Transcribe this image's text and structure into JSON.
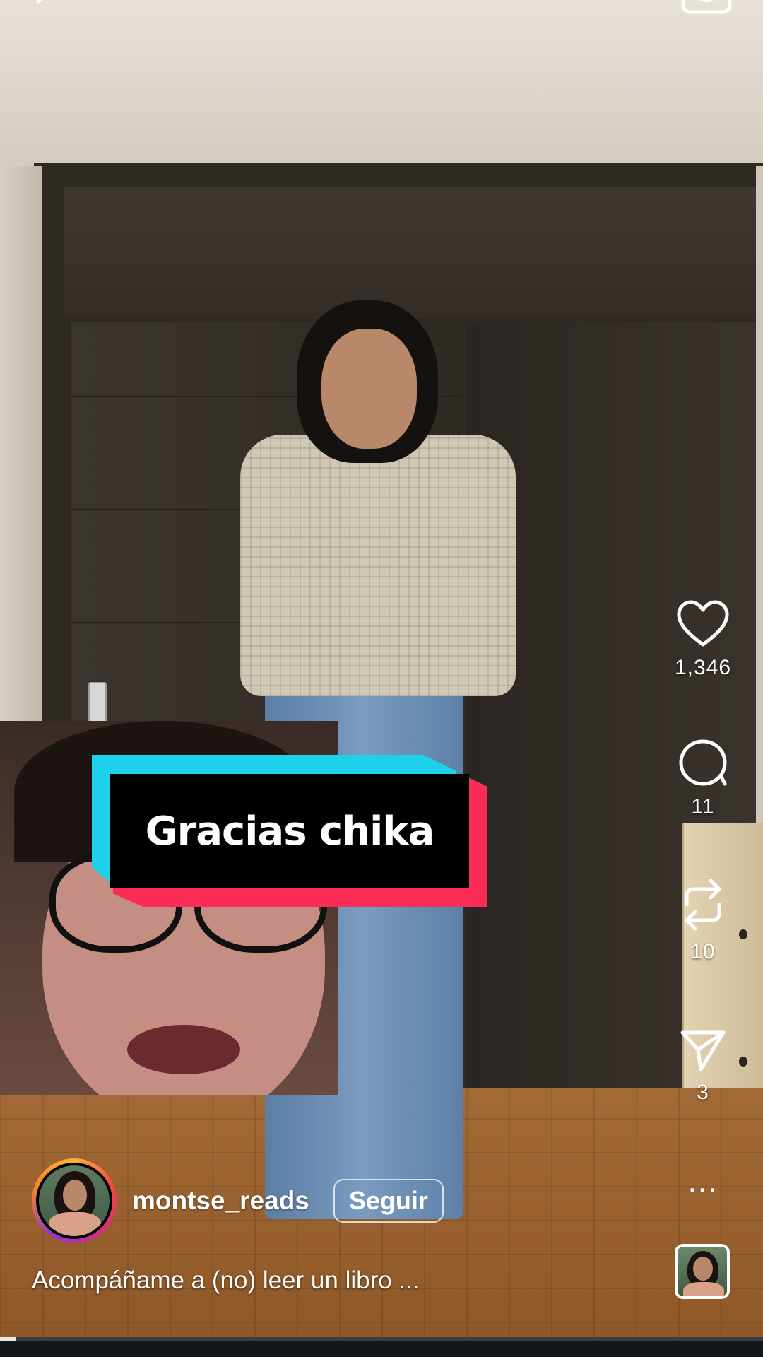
{
  "caption_sticker": {
    "text": "Gracias chika"
  },
  "actions": {
    "like": {
      "icon": "heart-icon",
      "count": "1,346"
    },
    "comment": {
      "icon": "comment-icon",
      "count": "11"
    },
    "repost": {
      "icon": "repost-icon",
      "count": "10"
    },
    "share": {
      "icon": "paper-plane-icon",
      "count": "3"
    },
    "more": {
      "icon": "more-icon",
      "label": "..."
    }
  },
  "author": {
    "username": "montse_reads",
    "follow_label": "Seguir"
  },
  "post": {
    "caption": "Acompáñame a (no) leer un libro ..."
  },
  "playback": {
    "progress": 0.02
  },
  "colors": {
    "sticker_cyan": "#1ed1ea",
    "sticker_red": "#fb2d57",
    "sticker_black": "#000000"
  }
}
